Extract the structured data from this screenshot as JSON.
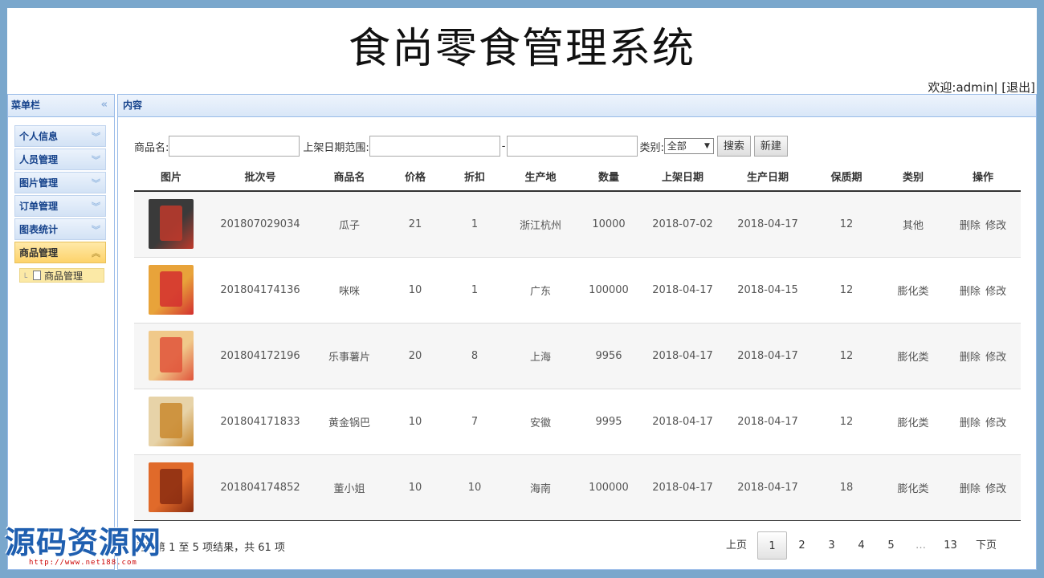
{
  "header": {
    "title": "食尚零食管理系统",
    "welcome_prefix": "欢迎:",
    "username": "admin",
    "separator": "|",
    "logout": "[退出]"
  },
  "sidebar": {
    "title": "菜单栏",
    "collapse_icon": "«",
    "items": [
      {
        "label": "个人信息",
        "active": false
      },
      {
        "label": "人员管理",
        "active": false
      },
      {
        "label": "图片管理",
        "active": false
      },
      {
        "label": "订单管理",
        "active": false
      },
      {
        "label": "图表统计",
        "active": false
      },
      {
        "label": "商品管理",
        "active": true
      }
    ],
    "sub_items": [
      {
        "label": "商品管理"
      }
    ]
  },
  "content": {
    "title": "内容",
    "search": {
      "name_label": "商品名:",
      "name_value": "",
      "date_label": "上架日期范围:",
      "date_from": "",
      "date_dash": "-",
      "date_to": "",
      "category_label": "类别:",
      "category_selected": "全部",
      "search_button": "搜索",
      "new_button": "新建"
    },
    "table": {
      "columns": [
        "图片",
        "批次号",
        "商品名",
        "价格",
        "折扣",
        "生产地",
        "数量",
        "上架日期",
        "生产日期",
        "保质期",
        "类别",
        "操作"
      ],
      "rows": [
        {
          "batch": "201807029034",
          "name": "瓜子",
          "price": "21",
          "discount": "1",
          "origin": "浙江杭州",
          "qty": "10000",
          "shelf_date": "2018-07-02",
          "prod_date": "2018-04-17",
          "shelf_life": "12",
          "category": "其他",
          "thumb_color": "#3a3a3a",
          "thumb_accent": "#c0392b"
        },
        {
          "batch": "201804174136",
          "name": "咪咪",
          "price": "10",
          "discount": "1",
          "origin": "广东",
          "qty": "100000",
          "shelf_date": "2018-04-17",
          "prod_date": "2018-04-15",
          "shelf_life": "12",
          "category": "膨化类",
          "thumb_color": "#e8a33a",
          "thumb_accent": "#d32f2f"
        },
        {
          "batch": "201804172196",
          "name": "乐事薯片",
          "price": "20",
          "discount": "8",
          "origin": "上海",
          "qty": "9956",
          "shelf_date": "2018-04-17",
          "prod_date": "2018-04-17",
          "shelf_life": "12",
          "category": "膨化类",
          "thumb_color": "#f0c98a",
          "thumb_accent": "#e0533a"
        },
        {
          "batch": "201804171833",
          "name": "黄金锅巴",
          "price": "10",
          "discount": "7",
          "origin": "安徽",
          "qty": "9995",
          "shelf_date": "2018-04-17",
          "prod_date": "2018-04-17",
          "shelf_life": "12",
          "category": "膨化类",
          "thumb_color": "#e7d3a8",
          "thumb_accent": "#c9882e"
        },
        {
          "batch": "201804174852",
          "name": "董小姐",
          "price": "10",
          "discount": "10",
          "origin": "海南",
          "qty": "100000",
          "shelf_date": "2018-04-17",
          "prod_date": "2018-04-17",
          "shelf_life": "18",
          "category": "膨化类",
          "thumb_color": "#e06a2a",
          "thumb_accent": "#8a2b10"
        }
      ],
      "delete_label": "删除",
      "edit_label": "修改"
    },
    "footer_info": "显示第 1 至 5 项结果，共 61 项",
    "pager": {
      "prev": "上页",
      "pages": [
        "1",
        "2",
        "3",
        "4",
        "5"
      ],
      "current": "1",
      "ellipsis": "…",
      "last": "13",
      "next": "下页"
    }
  },
  "watermark": {
    "text": "源码资源网",
    "url": "http://www.net188.com"
  }
}
